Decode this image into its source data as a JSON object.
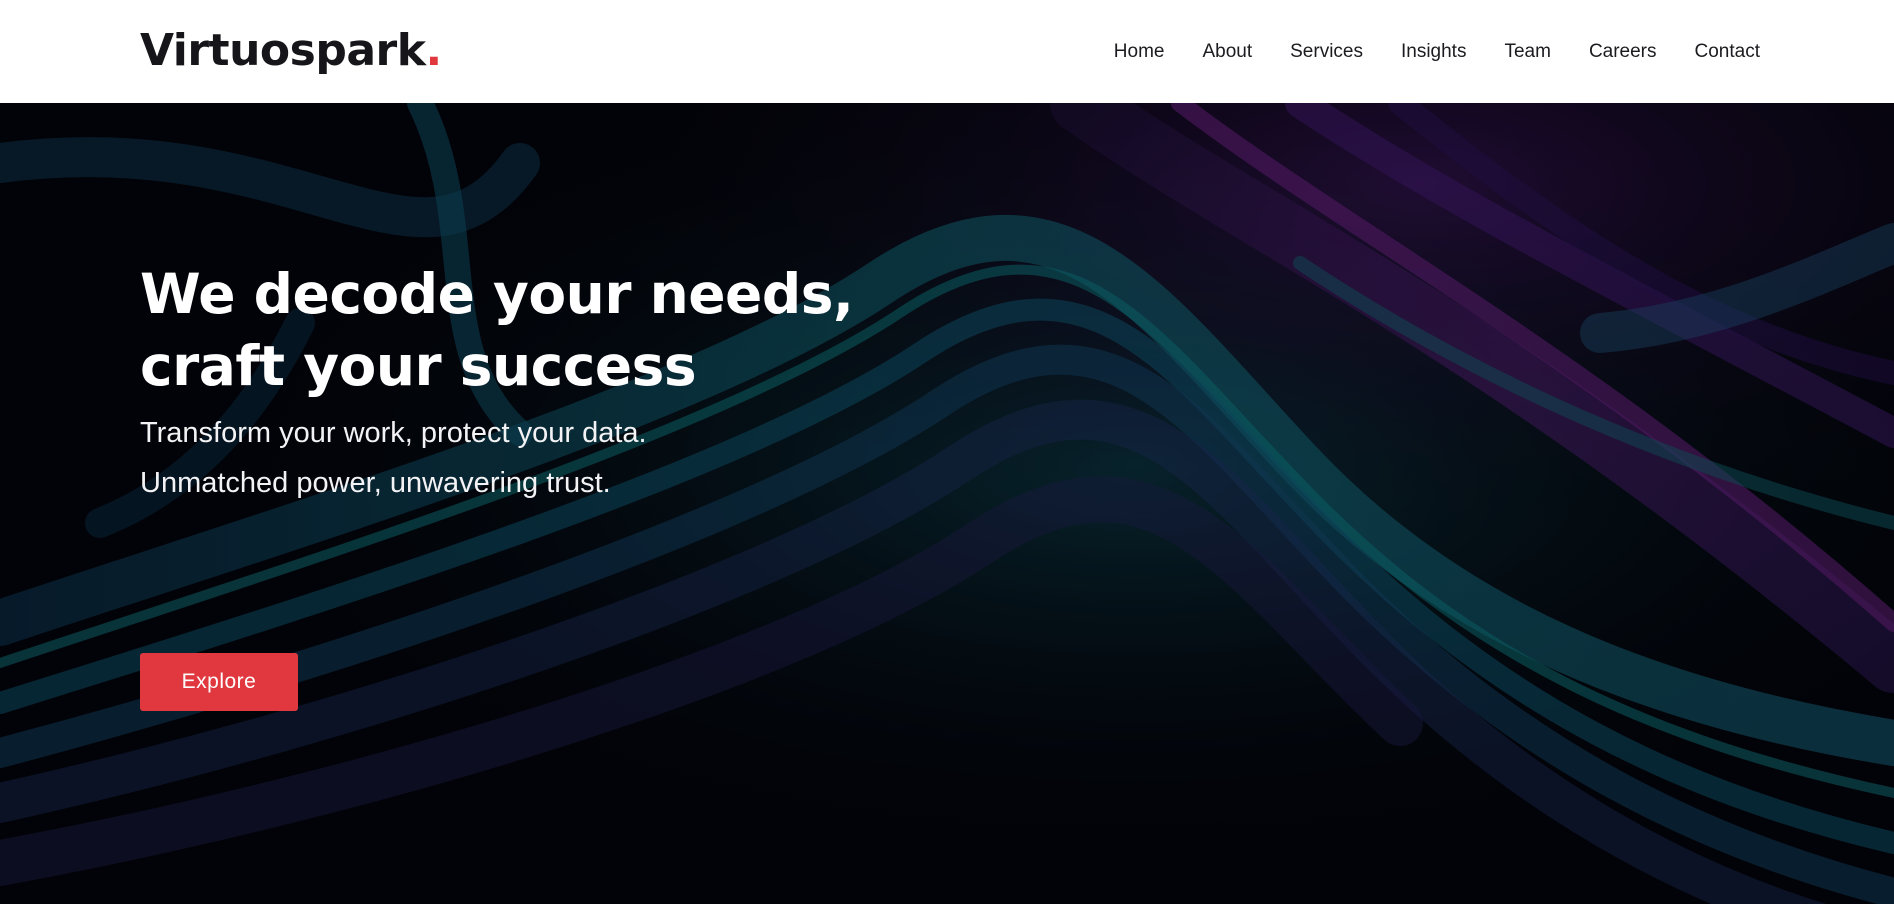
{
  "header": {
    "logo_text": "Virtuospark",
    "logo_dot": ".",
    "nav": [
      "Home",
      "About",
      "Services",
      "Insights",
      "Team",
      "Careers",
      "Contact"
    ]
  },
  "hero": {
    "headline_line1": "We decode your needs,",
    "headline_line2": "craft your success",
    "subline1": "Transform your work, protect your data.",
    "subline2": "Unmatched power, unwavering trust.",
    "cta_label": "Explore"
  },
  "colors": {
    "accent": "#e0383e",
    "hero_background": "#03040a",
    "header_background": "#ffffff",
    "text_dark": "#16161a"
  }
}
